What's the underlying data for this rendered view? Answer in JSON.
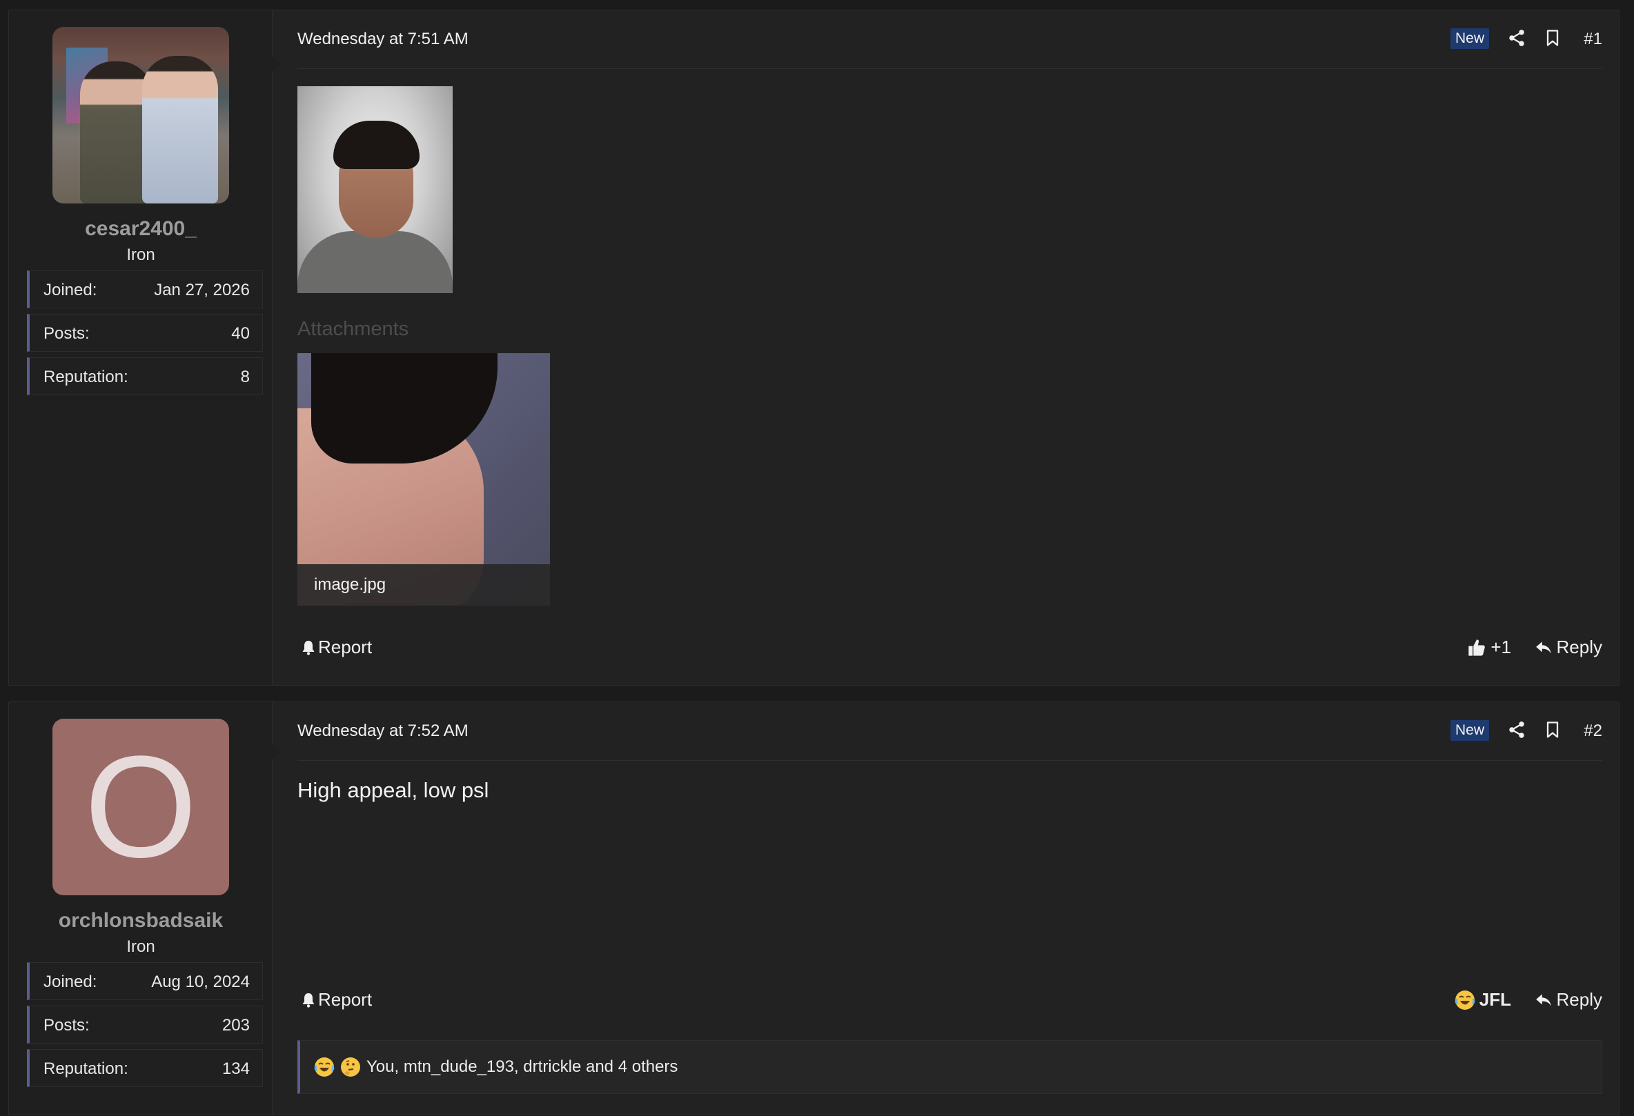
{
  "colors": {
    "background": "#1b1b1b",
    "panel": "#222222",
    "user_panel": "#1f1f1f",
    "accent_border": "#5b5c8f",
    "badge_bg": "#1e3a6f",
    "avatar_letter_bg": "#9b6b67",
    "username": "#9c9c9c"
  },
  "posts": [
    {
      "user": {
        "username": "cesar2400_",
        "title": "Iron",
        "avatar_type": "photo",
        "stats": [
          {
            "label": "Joined:",
            "value": "Jan 27, 2026"
          },
          {
            "label": "Posts:",
            "value": "40"
          },
          {
            "label": "Reputation:",
            "value": "8"
          }
        ]
      },
      "date": "Wednesday at 7:51 AM",
      "badge": "New",
      "number": "#1",
      "attachments_heading": "Attachments",
      "attachment_name": "image.jpg",
      "report_label": "Report",
      "reaction_label": "+1",
      "reaction_icon": "thumbs-up-icon",
      "reply_label": "Reply"
    },
    {
      "user": {
        "username": "orchlonsbadsaik",
        "title": "Iron",
        "avatar_type": "letter",
        "avatar_letter": "O",
        "stats": [
          {
            "label": "Joined:",
            "value": "Aug 10, 2024"
          },
          {
            "label": "Posts:",
            "value": "203"
          },
          {
            "label": "Reputation:",
            "value": "134"
          }
        ]
      },
      "date": "Wednesday at 7:52 AM",
      "badge": "New",
      "number": "#2",
      "text": "High appeal, low psl",
      "report_label": "Report",
      "reaction_label": "JFL",
      "reaction_icon": "crying-laughing-emoji-icon",
      "reply_label": "Reply",
      "reactions_summary": "You, mtn_dude_193, drtrickle and 4 others"
    }
  ]
}
